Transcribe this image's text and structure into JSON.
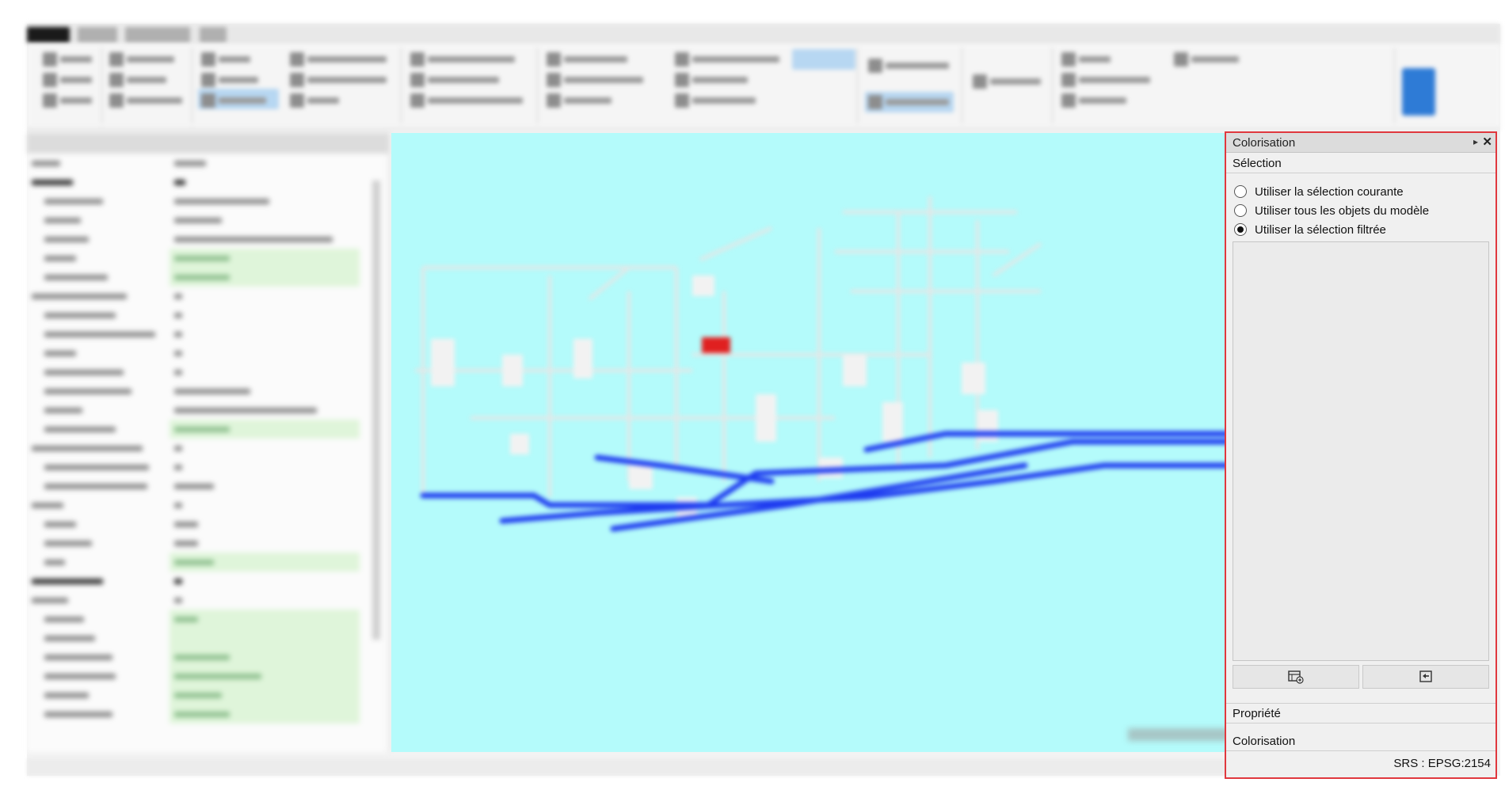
{
  "colorisation_panel": {
    "title": "Colorisation",
    "selection_section": {
      "header": "Sélection",
      "options": [
        {
          "label": "Utiliser la sélection courante",
          "selected": false
        },
        {
          "label": "Utiliser tous les objets du modèle",
          "selected": false
        },
        {
          "label": "Utiliser la sélection filtrée",
          "selected": true
        }
      ]
    },
    "buttons": [
      {
        "icon": "filter-add-icon"
      },
      {
        "icon": "filter-remove-icon"
      }
    ],
    "section_propriete": "Propriété",
    "section_colorisation": "Colorisation",
    "status_srs": "SRS : EPSG:2154"
  },
  "colors": {
    "viewport_background": "#b4fbfb",
    "highlight_border": "#e0383e",
    "pipe_blue": "#1f3cf0",
    "selected_element": "#e02020"
  }
}
